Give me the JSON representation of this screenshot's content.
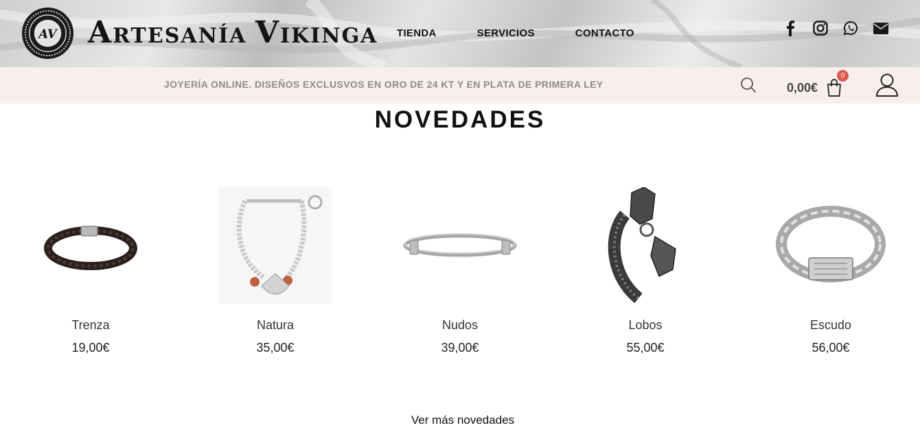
{
  "header": {
    "logo_monogram": "AV",
    "logo_words": [
      {
        "cap": "A",
        "rest": "RTESANÍA "
      },
      {
        "cap": "V",
        "rest": "IKINGA"
      }
    ],
    "nav": [
      "TIENDA",
      "SERVICIOS",
      "CONTACTO"
    ],
    "social": [
      "facebook-icon",
      "instagram-icon",
      "whatsapp-icon",
      "envelope-icon"
    ]
  },
  "infobar": {
    "tagline": "JOYERÍA ONLINE. DISEÑOS EXCLUSVOS EN ORO DE 24 KT Y EN PLATA DE PRIMERA LEY",
    "cart_total": "0,00€",
    "cart_count": "0",
    "icons": [
      "search-icon",
      "shopping-bag-icon",
      "user-icon"
    ]
  },
  "section": {
    "title": "NOVEDADES",
    "products": [
      {
        "name": "Trenza",
        "price": "19,00€"
      },
      {
        "name": "Natura",
        "price": "35,00€"
      },
      {
        "name": "Nudos",
        "price": "39,00€"
      },
      {
        "name": "Lobos",
        "price": "55,00€"
      },
      {
        "name": "Escudo",
        "price": "56,00€"
      }
    ],
    "more_label": "Ver más novedades"
  },
  "colors": {
    "infobar_bg": "#f8efed",
    "badge": "#e05a52",
    "tagline": "#8b8b8b"
  }
}
